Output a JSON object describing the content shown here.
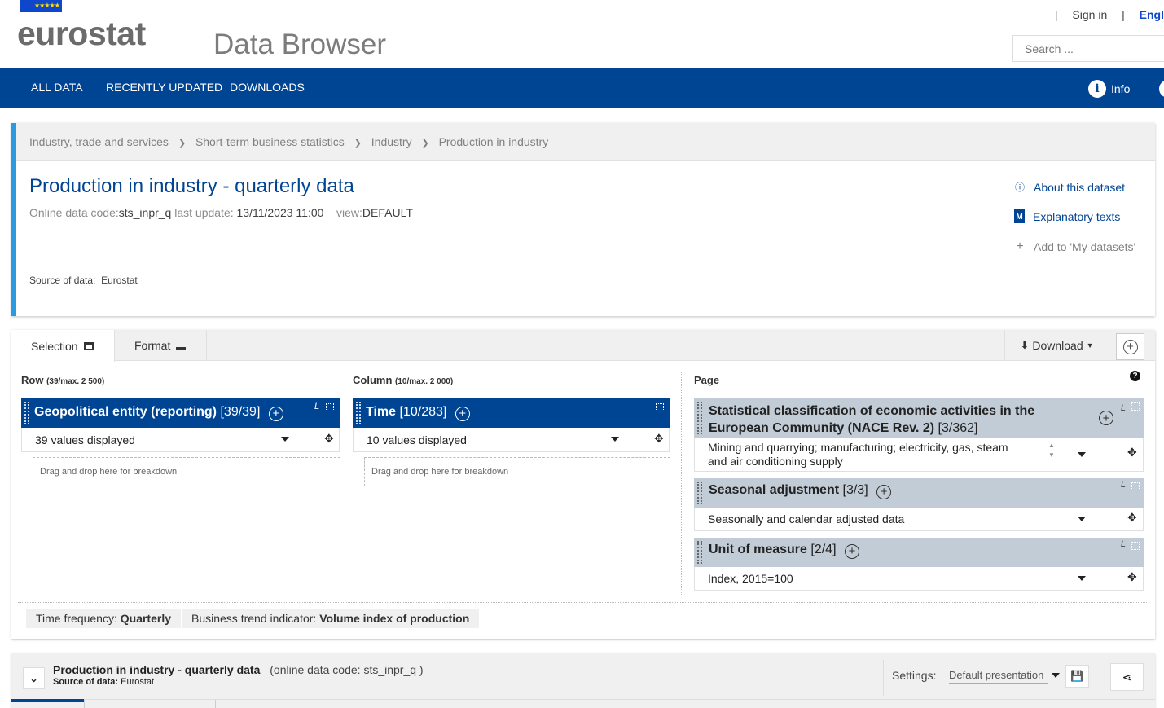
{
  "header": {
    "logo": "eurostat",
    "eu_stars": "★★★★★",
    "app_title": "Data Browser",
    "sep": "|",
    "sign_in": "Sign in",
    "language": "Engl",
    "search_placeholder": "Search ..."
  },
  "nav": {
    "items": [
      "ALL DATA",
      "RECENTLY UPDATED",
      "DOWNLOADS"
    ],
    "info": "Info"
  },
  "dataset": {
    "breadcrumb": [
      "Industry, trade and services",
      "Short-term business statistics",
      "Industry",
      "Production in industry"
    ],
    "bc_sep": "❯",
    "title": "Production in industry - quarterly data",
    "code_label": "Online data code:",
    "code": "sts_inpr_q",
    "update_label": "last update:",
    "update": "13/11/2023 11:00",
    "view_label": "view:",
    "view": "DEFAULT",
    "source_label": "Source of data:",
    "source": "Eurostat",
    "links": {
      "about": "About this dataset",
      "explanatory": "Explanatory texts",
      "add": "Add to 'My datasets'"
    }
  },
  "selection": {
    "tabs": {
      "selection": "Selection",
      "format": "Format"
    },
    "download": "Download",
    "row": {
      "label": "Row",
      "limit": "(39/max. 2 500)",
      "dim_name": "Geopolitical entity (reporting)",
      "dim_count": "[39/39]",
      "value": "39 values displayed",
      "drop": "Drag and drop here for breakdown"
    },
    "column": {
      "label": "Column",
      "limit": "(10/max. 2 000)",
      "dim_name": "Time",
      "dim_count": "[10/283]",
      "value": "10 values displayed",
      "drop": "Drag and drop here for breakdown"
    },
    "page": {
      "label": "Page",
      "help": "?",
      "items": [
        {
          "name": "Statistical classification of economic activities in the European Community (NACE Rev. 2)",
          "count": "[3/362]",
          "value": "Mining and quarrying; manufacturing; electricity, gas, steam and air conditioning supply"
        },
        {
          "name": "Seasonal adjustment",
          "count": "[3/3]",
          "value": "Seasonally and calendar adjusted data"
        },
        {
          "name": "Unit of measure",
          "count": "[2/4]",
          "value": "Index, 2015=100"
        }
      ]
    },
    "corner_letter": "L",
    "filters": [
      {
        "label": "Time frequency:",
        "value": "Quarterly"
      },
      {
        "label": "Business trend indicator:",
        "value": "Volume index of production"
      }
    ]
  },
  "bottom": {
    "title": "Production in industry - quarterly data",
    "code": "(online data code: sts_inpr_q )",
    "source_label": "Source of data:",
    "source": "Eurostat",
    "settings_label": "Settings:",
    "settings_value": "Default presentation"
  },
  "colors": {
    "brand": "#004494",
    "accent": "#2b9ae0",
    "page_dim": "#c2ccd6"
  }
}
